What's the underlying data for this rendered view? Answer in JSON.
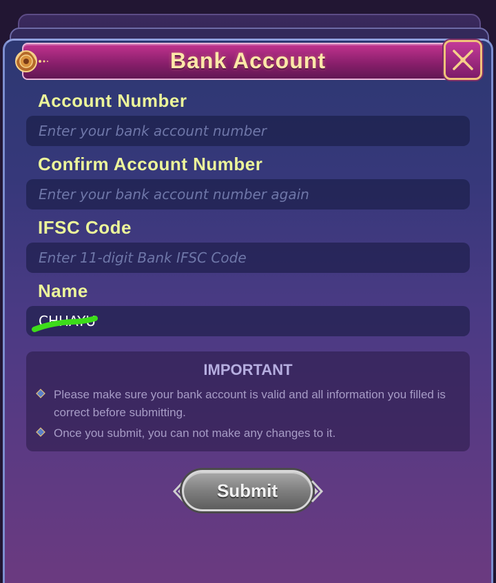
{
  "dialog": {
    "title": "Bank Account",
    "close_icon": "close-icon"
  },
  "fields": {
    "account_number": {
      "label": "Account Number",
      "placeholder": "Enter your bank account number",
      "value": ""
    },
    "confirm_account_number": {
      "label": "Confirm Account Number",
      "placeholder": "Enter your bank account number again",
      "value": ""
    },
    "ifsc_code": {
      "label": "IFSC Code",
      "placeholder": "Enter 11-digit Bank IFSC Code",
      "value": ""
    },
    "name": {
      "label": "Name",
      "value": "CHHAYU"
    }
  },
  "important": {
    "title": "IMPORTANT",
    "notices": [
      "Please make sure your bank account is valid and all information you filled is correct before submitting.",
      "Once you submit, you can not make any changes to it."
    ],
    "bullet_icon": "diamond-bullet-icon"
  },
  "submit": {
    "label": "Submit"
  },
  "colors": {
    "label": "#ecf59a",
    "title_text": "#ffe7a8",
    "title_bar": "#a82a80",
    "placeholder": "#6e76a8",
    "important_title": "#b6aee0",
    "redaction_mark": "#3ddc1a"
  }
}
